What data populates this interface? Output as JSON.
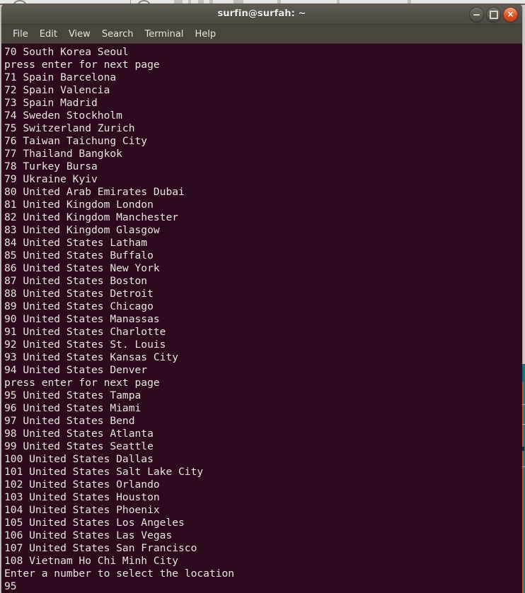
{
  "window": {
    "title": "surfin@surfah: ~",
    "controls": {
      "minimize_label": "–",
      "maximize_label": "□",
      "close_label": "×"
    }
  },
  "menubar": {
    "items": [
      {
        "label": "File"
      },
      {
        "label": "Edit"
      },
      {
        "label": "View"
      },
      {
        "label": "Search"
      },
      {
        "label": "Terminal"
      },
      {
        "label": "Help"
      }
    ]
  },
  "terminal": {
    "prompt_message": "Enter a number to select the location",
    "paging_message": "press enter for next page",
    "typed_input": "95",
    "lines": [
      "70 South Korea Seoul",
      "press enter for next page",
      "71 Spain Barcelona",
      "72 Spain Valencia",
      "73 Spain Madrid",
      "74 Sweden Stockholm",
      "75 Switzerland Zurich",
      "76 Taiwan Taichung City",
      "77 Thailand Bangkok",
      "78 Turkey Bursa",
      "79 Ukraine Kyiv",
      "80 United Arab Emirates Dubai",
      "81 United Kingdom London",
      "82 United Kingdom Manchester",
      "83 United Kingdom Glasgow",
      "84 United States Latham",
      "85 United States Buffalo",
      "86 United States New York",
      "87 United States Boston",
      "88 United States Detroit",
      "89 United States Chicago",
      "90 United States Manassas",
      "91 United States Charlotte",
      "92 United States St. Louis",
      "93 United States Kansas City",
      "94 United States Denver",
      "press enter for next page",
      "95 United States Tampa",
      "96 United States Miami",
      "97 United States Bend",
      "98 United States Atlanta",
      "99 United States Seattle",
      "100 United States Dallas",
      "101 United States Salt Lake City",
      "102 United States Orlando",
      "103 United States Houston",
      "104 United States Phoenix",
      "105 United States Los Angeles",
      "106 United States Las Vegas",
      "107 United States San Francisco",
      "108 Vietnam Ho Chi Minh City",
      "Enter a number to select the location",
      "95"
    ]
  },
  "colors": {
    "terminal_background": "#2d0a1e",
    "terminal_text": "#e8e4df",
    "titlebar": "#55504a",
    "menubar": "#4a443f",
    "close_button": "#db4d1e",
    "desktop": "#cfcac6",
    "background_app_teal": "#117a82",
    "background_app_orange": "#d4603c"
  }
}
